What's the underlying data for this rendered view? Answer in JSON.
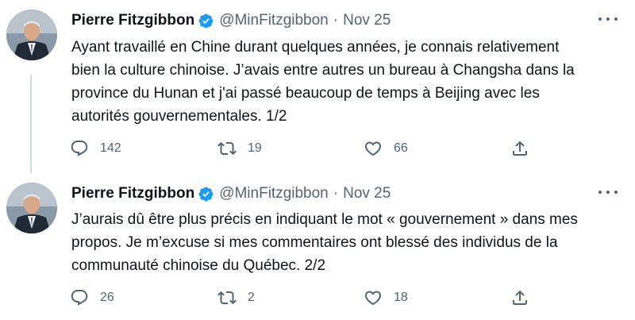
{
  "tweets": [
    {
      "display_name": "Pierre Fitzgibbon",
      "handle": "@MinFitzgibbon",
      "separator": "·",
      "date": "Nov 25",
      "text_lines": [
        "Ayant travaillé en Chine durant quelques années, je connais relativement",
        "bien la culture chinoise. J’avais entre autres un bureau à Changsha dans la",
        "province du Hunan et j'ai passé beaucoup de temps à Beijing avec les",
        "autorités gouvernementales. 1/2"
      ],
      "replies": "142",
      "retweets": "19",
      "likes": "66"
    },
    {
      "display_name": "Pierre Fitzgibbon",
      "handle": "@MinFitzgibbon",
      "separator": "·",
      "date": "Nov 25",
      "text_lines": [
        "J’aurais dû être plus précis en indiquant le mot « gouvernement » dans mes",
        "propos. Je m’excuse si mes commentaires ont blessé des individus de la",
        "communauté chinoise du Québec. 2/2"
      ],
      "replies": "26",
      "retweets": "2",
      "likes": "18"
    }
  ],
  "icons": {
    "verified": "verified-badge-icon",
    "more": "more-options-icon",
    "reply": "reply-icon",
    "retweet": "retweet-icon",
    "like": "heart-icon",
    "share": "share-icon"
  },
  "colors": {
    "verified_blue": "#1d9bf0",
    "text": "#0f1419",
    "secondary": "#536471",
    "thread_line": "#cfd9de"
  }
}
